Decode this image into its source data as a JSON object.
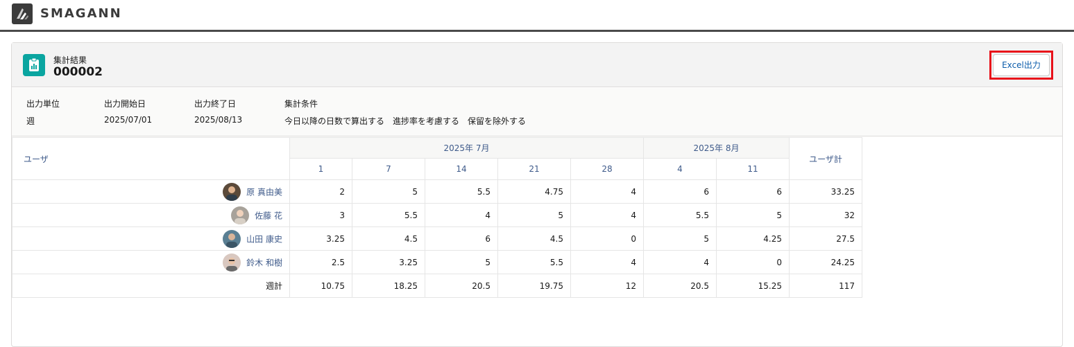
{
  "brand": {
    "name": "SMAGANN"
  },
  "record": {
    "label": "集計結果",
    "title": "000002",
    "excel_button": "Excel出力"
  },
  "params": {
    "unit_label": "出力単位",
    "unit_value": "週",
    "start_label": "出力開始日",
    "start_value": "2025/07/01",
    "end_label": "出力終了日",
    "end_value": "2025/08/13",
    "cond_label": "集計条件",
    "cond_value": "今日以降の日数で算出する　進捗率を考慮する　保留を除外する"
  },
  "table": {
    "user_header": "ユーザ",
    "total_header": "ユーザ計",
    "months": [
      {
        "label": "2025年 7月"
      },
      {
        "label": "2025年 8月"
      }
    ],
    "days": [
      "1",
      "7",
      "14",
      "21",
      "28",
      "4",
      "11"
    ],
    "rows": [
      {
        "name": "原 真由美",
        "values": [
          "2",
          "5",
          "5.5",
          "4.75",
          "4",
          "6",
          "6"
        ],
        "total": "33.25",
        "avatar_color": "#5b4a3a"
      },
      {
        "name": "佐藤 花",
        "values": [
          "3",
          "5.5",
          "4",
          "5",
          "4",
          "5.5",
          "5"
        ],
        "total": "32",
        "avatar_color": "#a8a29a"
      },
      {
        "name": "山田 康史",
        "values": [
          "3.25",
          "4.5",
          "6",
          "4.5",
          "0",
          "5",
          "4.25"
        ],
        "total": "27.5",
        "avatar_color": "#5a7f93"
      },
      {
        "name": "鈴木 和樹",
        "values": [
          "2.5",
          "3.25",
          "5",
          "5.5",
          "4",
          "4",
          "0"
        ],
        "total": "24.25",
        "avatar_color": "#d9c8c0"
      }
    ],
    "sum_row": {
      "label": "週計",
      "values": [
        "10.75",
        "18.25",
        "20.5",
        "19.75",
        "12",
        "20.5",
        "15.25"
      ],
      "total": "117"
    }
  },
  "colors": {
    "accent": "#0aa5a0",
    "link": "#3e5a8a",
    "highlight": "#e8111a"
  }
}
